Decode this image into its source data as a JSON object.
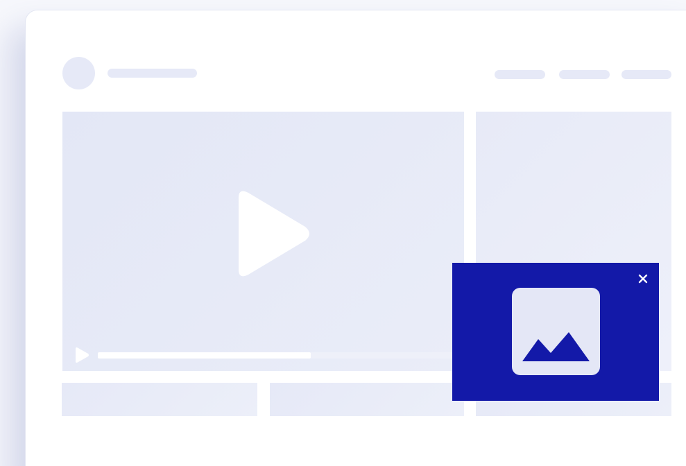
{
  "page": {
    "description_text": ""
  },
  "header": {
    "nav_items": [
      "",
      "",
      ""
    ]
  },
  "video": {
    "progress": 0.59
  },
  "popup_ad": {
    "close_symbol": "×",
    "image_icon": "mountain-image-icon",
    "background_color": "#1319a8"
  },
  "colors": {
    "placeholder": "#e6e9f7",
    "window": "#ffffff",
    "accent": "#1319a8"
  }
}
